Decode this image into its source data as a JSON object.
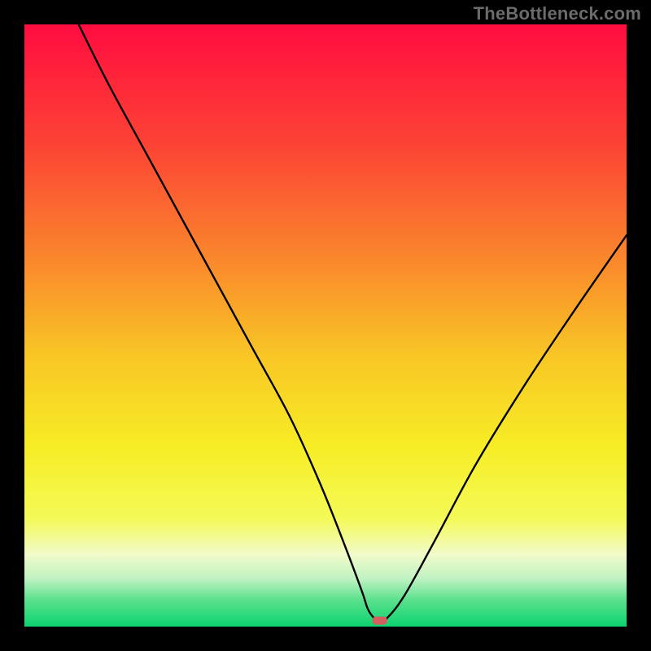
{
  "watermark": "TheBottleneck.com",
  "chart_data": {
    "type": "line",
    "title": "",
    "xlabel": "",
    "ylabel": "",
    "xlim": [
      0,
      100
    ],
    "ylim": [
      0,
      100
    ],
    "gradient_stops": [
      {
        "offset": 0.0,
        "color": "#ff0d3f"
      },
      {
        "offset": 0.2,
        "color": "#fc4334"
      },
      {
        "offset": 0.4,
        "color": "#fa8b2c"
      },
      {
        "offset": 0.55,
        "color": "#f8c625"
      },
      {
        "offset": 0.7,
        "color": "#f7ed25"
      },
      {
        "offset": 0.82,
        "color": "#f4fa56"
      },
      {
        "offset": 0.88,
        "color": "#f2fbc9"
      },
      {
        "offset": 0.92,
        "color": "#c1f2c3"
      },
      {
        "offset": 0.955,
        "color": "#5de18e"
      },
      {
        "offset": 1.0,
        "color": "#0ad46e"
      }
    ],
    "series": [
      {
        "name": "bottleneck-curve",
        "x": [
          9,
          14,
          20,
          26,
          32,
          38,
          44,
          49,
          53,
          56,
          57,
          58,
          59,
          60,
          63,
          68,
          75,
          83,
          91,
          100
        ],
        "values": [
          100,
          90,
          79,
          68,
          57,
          46,
          35,
          24,
          14,
          6,
          3,
          1.5,
          1,
          1.2,
          5,
          14,
          27,
          40,
          52,
          65
        ]
      }
    ],
    "marker": {
      "x": 59,
      "y": 1,
      "color": "#d3605e",
      "rx": 4,
      "width": 18,
      "height": 10
    },
    "minimum_point": {
      "x": 59,
      "y": 1
    }
  }
}
